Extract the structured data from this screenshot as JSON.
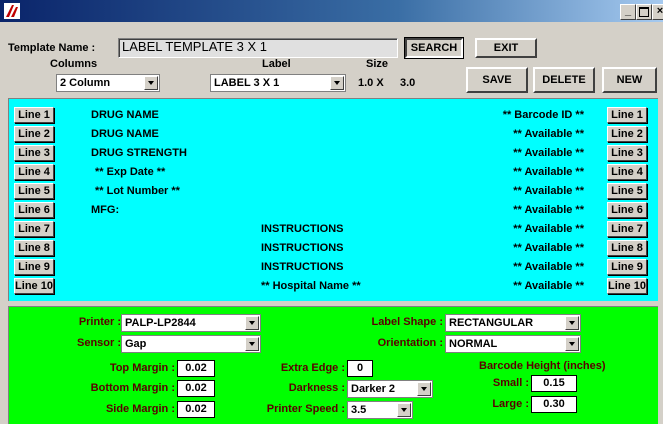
{
  "window": {
    "title": ""
  },
  "header": {
    "template_name_label": "Template Name :",
    "template_name_value": "LABEL TEMPLATE 3 X 1",
    "search_label": "SEARCH",
    "exit_label": "EXIT",
    "columns_label": "Columns",
    "columns_value": "2 Column",
    "label_label": "Label",
    "label_value": "LABEL 3 X 1",
    "size_label": "Size",
    "size_width": "1.0 X",
    "size_height": "3.0",
    "save_label": "SAVE",
    "delete_label": "DELETE",
    "new_label": "NEW"
  },
  "lines": [
    {
      "left_btn": "Line 1",
      "left_text": "DRUG NAME",
      "center_text": "",
      "right_text": "** Barcode ID **",
      "right_btn": "Line 1"
    },
    {
      "left_btn": "Line 2",
      "left_text": "DRUG NAME",
      "center_text": "",
      "right_text": "** Available **",
      "right_btn": "Line 2"
    },
    {
      "left_btn": "Line 3",
      "left_text": "DRUG STRENGTH",
      "center_text": "",
      "right_text": "** Available **",
      "right_btn": "Line 3"
    },
    {
      "left_btn": "Line 4",
      "left_text": "** Exp Date **",
      "center_text": "",
      "right_text": "** Available **",
      "right_btn": "Line 4"
    },
    {
      "left_btn": "Line 5",
      "left_text": "** Lot Number **",
      "center_text": "",
      "right_text": "** Available **",
      "right_btn": "Line 5"
    },
    {
      "left_btn": "Line 6",
      "left_text": "MFG:",
      "center_text": "",
      "right_text": "** Available **",
      "right_btn": "Line 6"
    },
    {
      "left_btn": "Line 7",
      "left_text": "",
      "center_text": "INSTRUCTIONS",
      "right_text": "** Available **",
      "right_btn": "Line 7"
    },
    {
      "left_btn": "Line 8",
      "left_text": "",
      "center_text": "INSTRUCTIONS",
      "right_text": "** Available **",
      "right_btn": "Line 8"
    },
    {
      "left_btn": "Line 9",
      "left_text": "",
      "center_text": "INSTRUCTIONS",
      "right_text": "** Available **",
      "right_btn": "Line 9"
    },
    {
      "left_btn": "Line 10",
      "left_text": "",
      "center_text": "** Hospital Name **",
      "right_text": "** Available **",
      "right_btn": "Line 10"
    }
  ],
  "settings": {
    "printer_label": "Printer :",
    "printer_value": "PALP-LP2844",
    "sensor_label": "Sensor :",
    "sensor_value": "Gap",
    "label_shape_label": "Label Shape :",
    "label_shape_value": "RECTANGULAR",
    "orientation_label": "Orientation :",
    "orientation_value": "NORMAL",
    "top_margin_label": "Top Margin :",
    "top_margin_value": "0.02",
    "bottom_margin_label": "Bottom Margin :",
    "bottom_margin_value": "0.02",
    "side_margin_label": "Side Margin :",
    "side_margin_value": "0.02",
    "extra_edge_label": "Extra Edge :",
    "extra_edge_value": "0",
    "darkness_label": "Darkness :",
    "darkness_value": "Darker 2",
    "printer_speed_label": "Printer Speed :",
    "printer_speed_value": "3.5",
    "barcode_height_label": "Barcode Height (inches)",
    "small_label": "Small :",
    "small_value": "0.15",
    "large_label": "Large :",
    "large_value": "0.30"
  },
  "colors": {
    "lines_panel": "#00ffff",
    "settings_panel": "#00ff00",
    "titlebar": "#0a246a"
  }
}
